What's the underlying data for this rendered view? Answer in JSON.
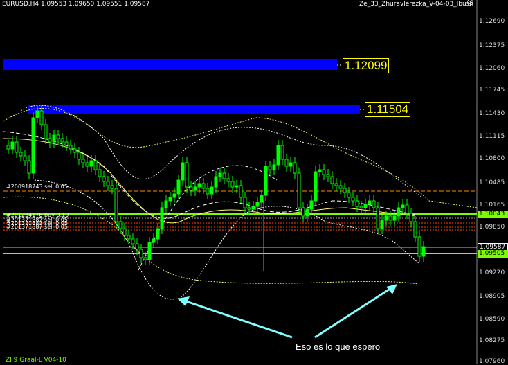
{
  "header": {
    "symbol_info": "EURUSD,H4  1.09553 1.09650 1.09551 1.09587",
    "indicator_name": "Ze_33_Zhuravlerezka_V-04-03_Ibush"
  },
  "price_axis": {
    "ticks": [
      "1.12690",
      "1.12375",
      "1.12060",
      "1.11745",
      "1.11430",
      "1.11115",
      "1.10800",
      "1.10485",
      "1.10165",
      "1.09850",
      "1.09220",
      "1.08905",
      "1.08590",
      "1.08275",
      "1.07960"
    ],
    "current_price": "1.09587",
    "level_a": "1.10043",
    "level_b": "1.09505"
  },
  "targets": {
    "upper": "1.12099",
    "lower": "1.11504"
  },
  "orders": {
    "o1": "#200918743 sell 0.05",
    "o2": "#201234176 buy 0.10",
    "o3": "#201371887 sell 0.05",
    "o4": "#201371887 sell 0.05",
    "o5": "#201371887 sell 0.05"
  },
  "annotation": "Eso es lo que espero",
  "footer": "ZI 9 Graal-L V04-10",
  "colors": {
    "candle": "#00ff00",
    "band": "#0000ff",
    "target_text": "#ffff00",
    "level_line": "#7cfc00",
    "arrow": "#7fffff",
    "envelope": "#ffff66"
  }
}
